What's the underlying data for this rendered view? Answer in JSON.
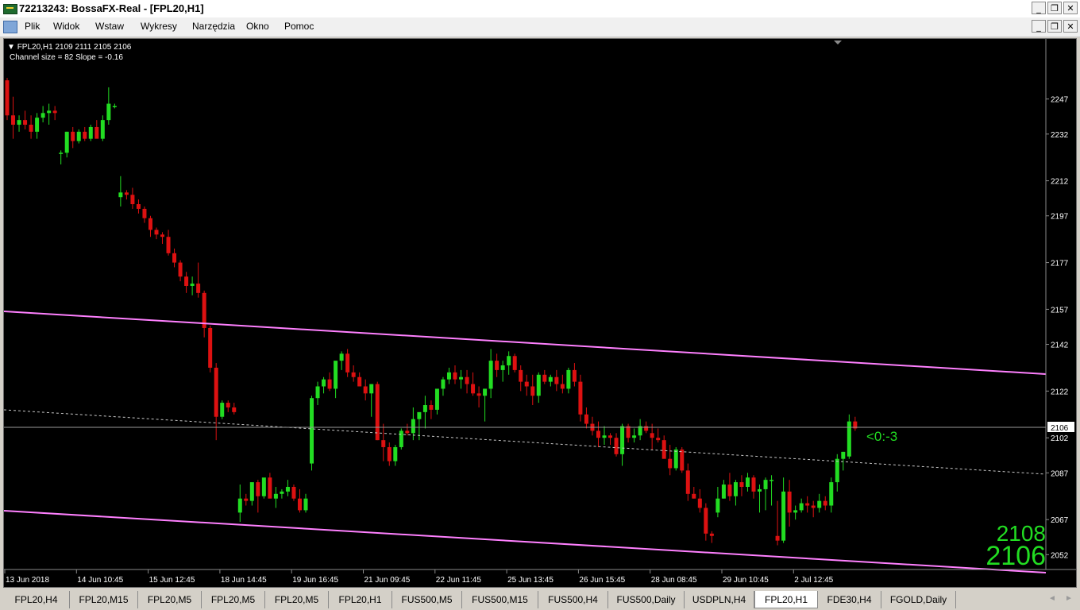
{
  "window": {
    "title": "72213243: BossaFX-Real - [FPL20,H1]"
  },
  "window_buttons": {
    "minimize": "_",
    "restore": "❐",
    "close": "✕"
  },
  "menu": [
    "Plik",
    "Widok",
    "Wstaw",
    "Wykresy",
    "Narzędzia",
    "Okno",
    "Pomoc"
  ],
  "chart": {
    "symbol_line": "FPL20,H1  2109 2111 2105 2106",
    "channel_line": "Channel size = 82 Slope = -0.16",
    "annotation": "<0:-3",
    "big_price_top": "2108",
    "big_price_bottom": "2106",
    "current_price_tag": "2106",
    "colors": {
      "bull": "#22dd22",
      "bear": "#dd1111",
      "channel": "#ff80ff",
      "text": "#ffffff",
      "bid_line": "#9a9a9a"
    }
  },
  "chart_data": {
    "type": "candlestick",
    "price_axis": [
      "2247",
      "2232",
      "2212",
      "2197",
      "2177",
      "2157",
      "2142",
      "2122",
      "2102",
      "2087",
      "2067",
      "2052"
    ],
    "time_axis": [
      "13 Jun 2018",
      "14 Jun 10:45",
      "15 Jun 12:45",
      "18 Jun 14:45",
      "19 Jun 16:45",
      "21 Jun 09:45",
      "22 Jun 11:45",
      "25 Jun 13:45",
      "26 Jun 15:45",
      "28 Jun 08:45",
      "29 Jun 10:45",
      "2 Jul 12:45"
    ],
    "ylim": [
      2047,
      2270
    ],
    "last": {
      "open": 2109,
      "high": 2111,
      "low": 2105,
      "close": 2106
    },
    "channel": {
      "size": 82,
      "slope": -0.16
    },
    "candles": [
      [
        2255,
        2256,
        2238,
        2240
      ],
      [
        2240,
        2248,
        2230,
        2236
      ],
      [
        2236,
        2240,
        2233,
        2238
      ],
      [
        2238,
        2242,
        2234,
        2236
      ],
      [
        2236,
        2240,
        2230,
        2233
      ],
      [
        2233,
        2241,
        2230,
        2239
      ],
      [
        2239,
        2244,
        2237,
        2241
      ],
      [
        2241,
        2245,
        2236,
        2242
      ],
      [
        2242,
        2244,
        2238,
        2241
      ],
      [
        2224,
        2225,
        2219,
        2224
      ],
      [
        2224,
        2233,
        2222,
        2233
      ],
      [
        2233,
        2235,
        2226,
        2229
      ],
      [
        2229,
        2234,
        2228,
        2233
      ],
      [
        2233,
        2235,
        2229,
        2230
      ],
      [
        2230,
        2236,
        2229,
        2235
      ],
      [
        2235,
        2238,
        2232,
        2230
      ],
      [
        2230,
        2240,
        2229,
        2238
      ],
      [
        2238,
        2252,
        2236,
        2245
      ],
      [
        2244,
        2245,
        2243,
        2244
      ],
      [
        2205,
        2214,
        2201,
        2207
      ],
      [
        2207,
        2208,
        2204,
        2206
      ],
      [
        2206,
        2209,
        2200,
        2202
      ],
      [
        2202,
        2204,
        2198,
        2200
      ],
      [
        2200,
        2201,
        2194,
        2196
      ],
      [
        2196,
        2197,
        2188,
        2191
      ],
      [
        2191,
        2192,
        2187,
        2189
      ],
      [
        2189,
        2190,
        2185,
        2188
      ],
      [
        2188,
        2191,
        2180,
        2181
      ],
      [
        2181,
        2183,
        2175,
        2177
      ],
      [
        2177,
        2178,
        2169,
        2171
      ],
      [
        2171,
        2173,
        2164,
        2167
      ],
      [
        2167,
        2171,
        2163,
        2168
      ],
      [
        2168,
        2177,
        2162,
        2164
      ],
      [
        2164,
        2165,
        2145,
        2149
      ],
      [
        2149,
        2150,
        2130,
        2132
      ],
      [
        2132,
        2134,
        2101,
        2111
      ],
      [
        2111,
        2118,
        2110,
        2117
      ],
      [
        2117,
        2118,
        2113,
        2115
      ],
      [
        2115,
        2117,
        2112,
        2113
      ],
      [
        2070,
        2082,
        2066,
        2076
      ],
      [
        2076,
        2078,
        2073,
        2075
      ],
      [
        2075,
        2080,
        2073,
        2083
      ],
      [
        2083,
        2084,
        2070,
        2077
      ],
      [
        2077,
        2083,
        2076,
        2085
      ],
      [
        2085,
        2087,
        2079,
        2076
      ],
      [
        2076,
        2081,
        2072,
        2078
      ],
      [
        2078,
        2080,
        2076,
        2079
      ],
      [
        2079,
        2084,
        2077,
        2081
      ],
      [
        2081,
        2082,
        2075,
        2076
      ],
      [
        2076,
        2080,
        2070,
        2071
      ],
      [
        2071,
        2078,
        2070,
        2076
      ],
      [
        2091,
        2120,
        2088,
        2119
      ],
      [
        2119,
        2126,
        2116,
        2124
      ],
      [
        2124,
        2128,
        2121,
        2127
      ],
      [
        2127,
        2130,
        2122,
        2123
      ],
      [
        2123,
        2133,
        2119,
        2135
      ],
      [
        2135,
        2139,
        2131,
        2138
      ],
      [
        2138,
        2140,
        2128,
        2130
      ],
      [
        2130,
        2133,
        2126,
        2128
      ],
      [
        2128,
        2130,
        2124,
        2124
      ],
      [
        2124,
        2127,
        2118,
        2121
      ],
      [
        2121,
        2123,
        2111,
        2125
      ],
      [
        2125,
        2126,
        2101,
        2101
      ],
      [
        2101,
        2108,
        2092,
        2098
      ],
      [
        2098,
        2100,
        2090,
        2092
      ],
      [
        2092,
        2099,
        2090,
        2098
      ],
      [
        2098,
        2106,
        2097,
        2105
      ],
      [
        2105,
        2108,
        2103,
        2104
      ],
      [
        2104,
        2115,
        2101,
        2110
      ],
      [
        2110,
        2112,
        2101,
        2113
      ],
      [
        2113,
        2120,
        2106,
        2116
      ],
      [
        2116,
        2118,
        2110,
        2114
      ],
      [
        2114,
        2122,
        2112,
        2123
      ],
      [
        2123,
        2128,
        2120,
        2127
      ],
      [
        2127,
        2132,
        2125,
        2130
      ],
      [
        2130,
        2133,
        2125,
        2127
      ],
      [
        2127,
        2131,
        2123,
        2128
      ],
      [
        2128,
        2131,
        2121,
        2125
      ],
      [
        2125,
        2130,
        2120,
        2121
      ],
      [
        2121,
        2124,
        2115,
        2120
      ],
      [
        2120,
        2123,
        2109,
        2123
      ],
      [
        2123,
        2140,
        2119,
        2135
      ],
      [
        2135,
        2138,
        2128,
        2131
      ],
      [
        2131,
        2135,
        2126,
        2133
      ],
      [
        2133,
        2139,
        2129,
        2137
      ],
      [
        2137,
        2138,
        2130,
        2131
      ],
      [
        2131,
        2133,
        2122,
        2126
      ],
      [
        2126,
        2129,
        2120,
        2124
      ],
      [
        2124,
        2129,
        2116,
        2120
      ],
      [
        2120,
        2130,
        2117,
        2129
      ],
      [
        2129,
        2131,
        2125,
        2126
      ],
      [
        2126,
        2129,
        2124,
        2128
      ],
      [
        2128,
        2131,
        2122,
        2125
      ],
      [
        2125,
        2129,
        2121,
        2123
      ],
      [
        2123,
        2132,
        2121,
        2131
      ],
      [
        2131,
        2134,
        2124,
        2126
      ],
      [
        2126,
        2129,
        2109,
        2112
      ],
      [
        2112,
        2115,
        2106,
        2108
      ],
      [
        2108,
        2111,
        2103,
        2105
      ],
      [
        2105,
        2109,
        2098,
        2102
      ],
      [
        2102,
        2107,
        2099,
        2103
      ],
      [
        2103,
        2104,
        2099,
        2102
      ],
      [
        2102,
        2104,
        2094,
        2095
      ],
      [
        2095,
        2108,
        2090,
        2107
      ],
      [
        2107,
        2108,
        2100,
        2102
      ],
      [
        2102,
        2106,
        2100,
        2103
      ],
      [
        2103,
        2110,
        2101,
        2107
      ],
      [
        2107,
        2109,
        2104,
        2105
      ],
      [
        2104,
        2108,
        2097,
        2102
      ],
      [
        2102,
        2106,
        2100,
        2101
      ],
      [
        2101,
        2103,
        2094,
        2093
      ],
      [
        2093,
        2099,
        2086,
        2089
      ],
      [
        2089,
        2098,
        2088,
        2097
      ],
      [
        2097,
        2098,
        2087,
        2088
      ],
      [
        2088,
        2091,
        2075,
        2078
      ],
      [
        2078,
        2081,
        2076,
        2076
      ],
      [
        2076,
        2080,
        2070,
        2072
      ],
      [
        2072,
        2074,
        2058,
        2061
      ],
      [
        2061,
        2062,
        2057,
        2060
      ],
      [
        2070,
        2081,
        2068,
        2076
      ],
      [
        2076,
        2084,
        2076,
        2082
      ],
      [
        2082,
        2087,
        2075,
        2077
      ],
      [
        2077,
        2084,
        2073,
        2083
      ],
      [
        2083,
        2086,
        2077,
        2081
      ],
      [
        2081,
        2087,
        2079,
        2085
      ],
      [
        2085,
        2086,
        2076,
        2079
      ],
      [
        2079,
        2082,
        2070,
        2080
      ],
      [
        2080,
        2085,
        2071,
        2084
      ],
      [
        2084,
        2086,
        2073,
        2084
      ],
      [
        2060,
        2075,
        2056,
        2058
      ],
      [
        2058,
        2085,
        2057,
        2079
      ],
      [
        2079,
        2084,
        2064,
        2070
      ],
      [
        2070,
        2073,
        2067,
        2071
      ],
      [
        2071,
        2076,
        2070,
        2074
      ],
      [
        2074,
        2077,
        2070,
        2073
      ],
      [
        2073,
        2075,
        2068,
        2072
      ],
      [
        2072,
        2078,
        2070,
        2075
      ],
      [
        2075,
        2077,
        2071,
        2073
      ],
      [
        2073,
        2085,
        2070,
        2083
      ],
      [
        2083,
        2095,
        2079,
        2093
      ],
      [
        2093,
        2096,
        2088,
        2096
      ],
      [
        2094,
        2112,
        2093,
        2109
      ],
      [
        2109,
        2111,
        2105,
        2106
      ]
    ]
  },
  "tabs": [
    "FPL20,H4",
    "FPL20,M15",
    "FPL20,M5",
    "FPL20,M5",
    "FPL20,M5",
    "FPL20,H1",
    "FUS500,M5",
    "FUS500,M15",
    "FUS500,H4",
    "FUS500,Daily",
    "USDPLN,H4",
    "FPL20,H1",
    "FDE30,H4",
    "FGOLD,Daily"
  ],
  "active_tab": 11,
  "scroll": {
    "left": "◄",
    "right": "►"
  }
}
